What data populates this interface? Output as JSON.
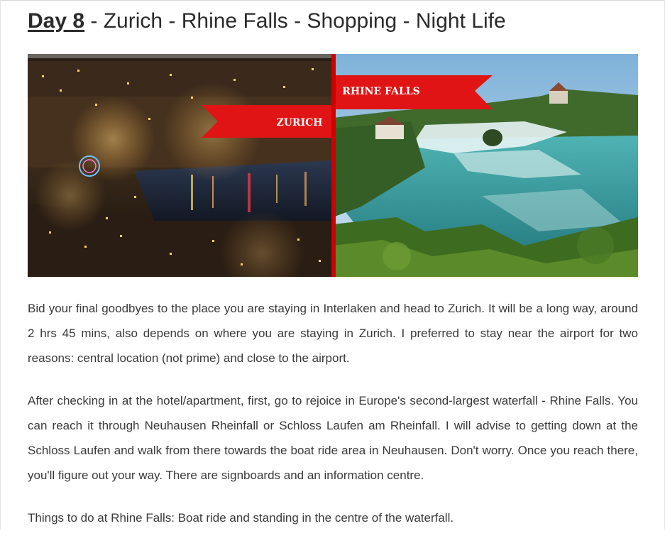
{
  "heading": {
    "day_label": "Day 8",
    "title_rest": " - Zurich - Rhine Falls - Shopping - Night Life"
  },
  "hero": {
    "labels": {
      "left": "ZURICH",
      "right": "RHINE FALLS"
    },
    "colors": {
      "ribbon": "#e01414",
      "divider": "#d10000",
      "water": "#2a8f95",
      "night": "#1b1410"
    }
  },
  "paragraphs": [
    "Bid your final goodbyes to the place you are staying in Interlaken and head to Zurich. It will be a long way, around 2 hrs 45 mins, also depends on where you are staying in Zurich. I preferred to stay near the airport for two reasons: central location (not prime) and close to the airport.",
    "After checking in at the hotel/apartment, first, go to rejoice in Europe's second-largest waterfall - Rhine Falls. You can reach it through Neuhausen Rheinfall or Schloss Laufen am Rheinfall. I will advise to getting down at the Schloss Laufen and walk from there towards the boat ride area in Neuhausen. Don't worry. Once you reach there, you'll figure out your way. There are signboards and an information centre.",
    "Things to do at Rhine Falls: Boat ride and standing in the centre of the waterfall."
  ]
}
